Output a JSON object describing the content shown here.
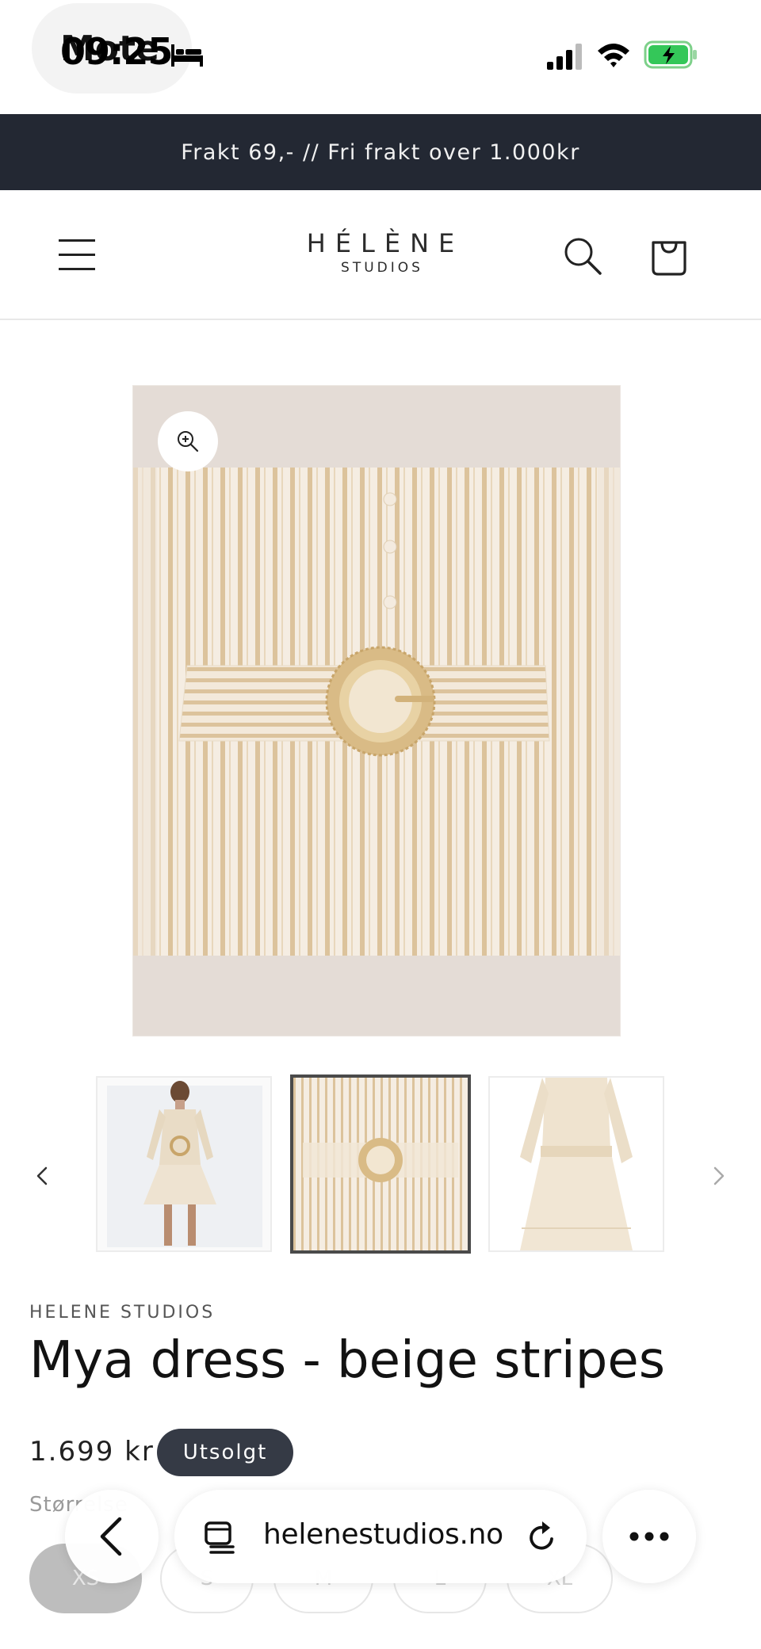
{
  "status_bar": {
    "time": "09:25",
    "app_label": "Mote",
    "icons": [
      "bed-icon",
      "signal-icon",
      "wifi-icon",
      "battery-charging-icon"
    ],
    "battery_color": "#34c759"
  },
  "announcement": {
    "text": "Frakt 69,- // Fri frakt over 1.000kr",
    "background": "#232833"
  },
  "header": {
    "logo_main": "HÉLÈNE",
    "logo_sub": "STUDIOS",
    "icons": [
      "menu-icon",
      "search-icon",
      "cart-icon"
    ]
  },
  "gallery": {
    "zoom_icon": "zoom-in-icon",
    "prev_icon": "chevron-left-icon",
    "next_icon": "chevron-right-icon",
    "selected_thumbnail": 2,
    "thumbnail_count": 3
  },
  "product": {
    "vendor": "HELENE STUDIOS",
    "title": "Mya dress - beige stripes",
    "price": "1.699 kr",
    "badge": "Utsolgt",
    "size_label": "Størrelse",
    "sizes": [
      "XS",
      "S",
      "M",
      "L",
      "XL"
    ]
  },
  "safari": {
    "url": "helenestudios.no",
    "icons": [
      "back-chevron-icon",
      "tabs-icon",
      "reload-icon",
      "more-icon"
    ]
  }
}
